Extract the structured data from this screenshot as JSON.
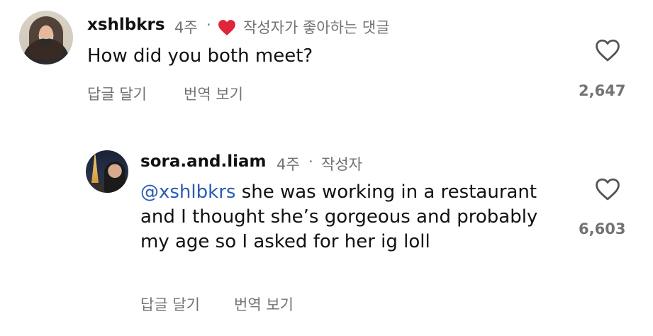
{
  "comments": [
    {
      "username": "xshlbkrs",
      "time": "4주",
      "separator": "·",
      "liked_by_author": "작성자가 좋아하는 댓글",
      "text": "How did you both meet?",
      "reply_label": "답글 달기",
      "translate_label": "번역 보기",
      "like_count": "2,647",
      "icons": {
        "avatar": "user-avatar",
        "author_like": "red-heart-icon",
        "like": "heart-outline-icon"
      },
      "colors": {
        "author_like_heart": "#e0243a"
      }
    },
    {
      "username": "sora.and.liam",
      "time": "4주",
      "separator": "·",
      "author_badge": "작성자",
      "mention": "@xshlbkrs",
      "text": " she was working in a restaurant and I thought she’s gorgeous and probably my age so I asked for her ig loll",
      "reply_label": "답글 달기",
      "translate_label": "번역 보기",
      "like_count": "6,603",
      "icons": {
        "avatar": "user-avatar",
        "like": "heart-outline-icon"
      },
      "colors": {
        "mention": "#2b5bb5"
      }
    }
  ]
}
